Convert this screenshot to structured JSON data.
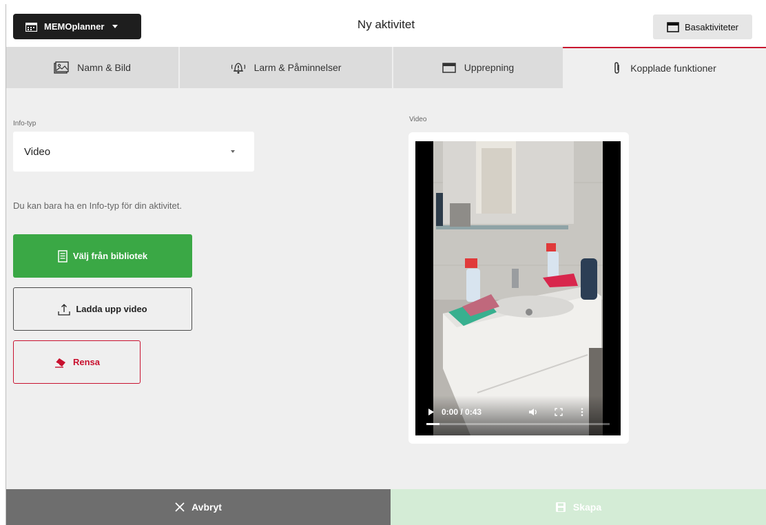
{
  "header": {
    "app_button_label": "MEMOplanner",
    "title": "Ny aktivitet",
    "basic_activities_label": "Basaktiviteter"
  },
  "tabs": [
    {
      "label": "Namn & Bild",
      "icon": "image-icon"
    },
    {
      "label": "Larm & Påminnelser",
      "icon": "alarm-bell-icon"
    },
    {
      "label": "Upprepning",
      "icon": "calendar-icon"
    },
    {
      "label": "Kopplade funktioner",
      "icon": "paperclip-icon",
      "active": true
    }
  ],
  "info_type": {
    "label": "Info-typ",
    "selected": "Video"
  },
  "note": "Du kan bara ha en Info-typ för din aktivitet.",
  "buttons": {
    "library": "Välj från bibliotek",
    "upload": "Ladda upp video",
    "clear": "Rensa"
  },
  "video": {
    "label": "Video",
    "time": "0:00 / 0:43",
    "progress": 0.07
  },
  "footer": {
    "cancel": "Avbryt",
    "create": "Skapa"
  },
  "colors": {
    "accent_red": "#c8102e",
    "green": "#3aa845",
    "create_disabled": "#d4ecd6",
    "cancel_grey": "#6e6e6e"
  }
}
